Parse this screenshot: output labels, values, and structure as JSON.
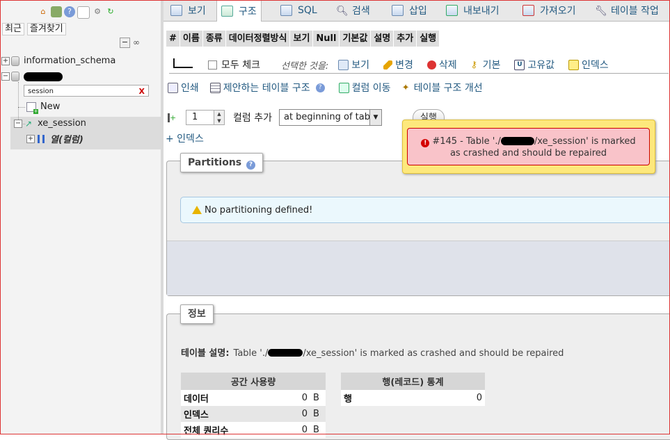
{
  "nav": {
    "tabs": [
      "최근",
      "즐겨찾기"
    ],
    "tree": {
      "db1": "information_schema",
      "search_value": "session",
      "new_label": "New",
      "table_name": "xe_session",
      "columns_label": "열(컬럼)"
    }
  },
  "tabs": [
    {
      "label": "보기",
      "icon": "browse-icon"
    },
    {
      "label": "구조",
      "icon": "structure-icon"
    },
    {
      "label": "SQL",
      "icon": "sql-icon"
    },
    {
      "label": "검색",
      "icon": "search-icon"
    },
    {
      "label": "삽입",
      "icon": "insert-icon"
    },
    {
      "label": "내보내기",
      "icon": "export-icon"
    },
    {
      "label": "가져오기",
      "icon": "import-icon"
    },
    {
      "label": "테이블 작업",
      "icon": "operations-icon"
    }
  ],
  "structure": {
    "headers": [
      "#",
      "이름",
      "종류",
      "데이터정렬방식",
      "보기",
      "Null",
      "기본값",
      "설명",
      "추가",
      "실행"
    ],
    "check_all": "모두 체크",
    "with_selected": "선택한 것을:",
    "actions": [
      "보기",
      "변경",
      "삭제",
      "기본",
      "고유값",
      "인덱스"
    ],
    "tools": [
      "인쇄",
      "제안하는 테이블 구조",
      "컬럼 이동",
      "테이블 구조 개선"
    ],
    "add_count": "1",
    "add_label": "컬럼 추가",
    "add_position": "at beginning of table",
    "execute": "실행",
    "index_link": "+ 인덱스"
  },
  "partitions": {
    "legend": "Partitions",
    "notice": "No partitioning defined!"
  },
  "error": {
    "line1_prefix": "#145 - Table './",
    "line1_suffix": "/xe_session' is marked",
    "line2": "as crashed and should be repaired"
  },
  "info": {
    "legend": "정보",
    "desc_label": "테이블 설명:",
    "desc_prefix": "Table './",
    "desc_suffix": "/xe_session' is marked as crashed and should be repaired",
    "space_header": "공간 사용량",
    "space_rows": [
      {
        "label": "데이터",
        "value": "0",
        "unit": "B"
      },
      {
        "label": "인덱스",
        "value": "0",
        "unit": "B"
      },
      {
        "label": "전체 퀀리수",
        "value": "0",
        "unit": "B"
      }
    ],
    "rows_header": "행(레코드) 통계",
    "rows_rows": [
      {
        "label": "행",
        "value": "0"
      }
    ]
  }
}
